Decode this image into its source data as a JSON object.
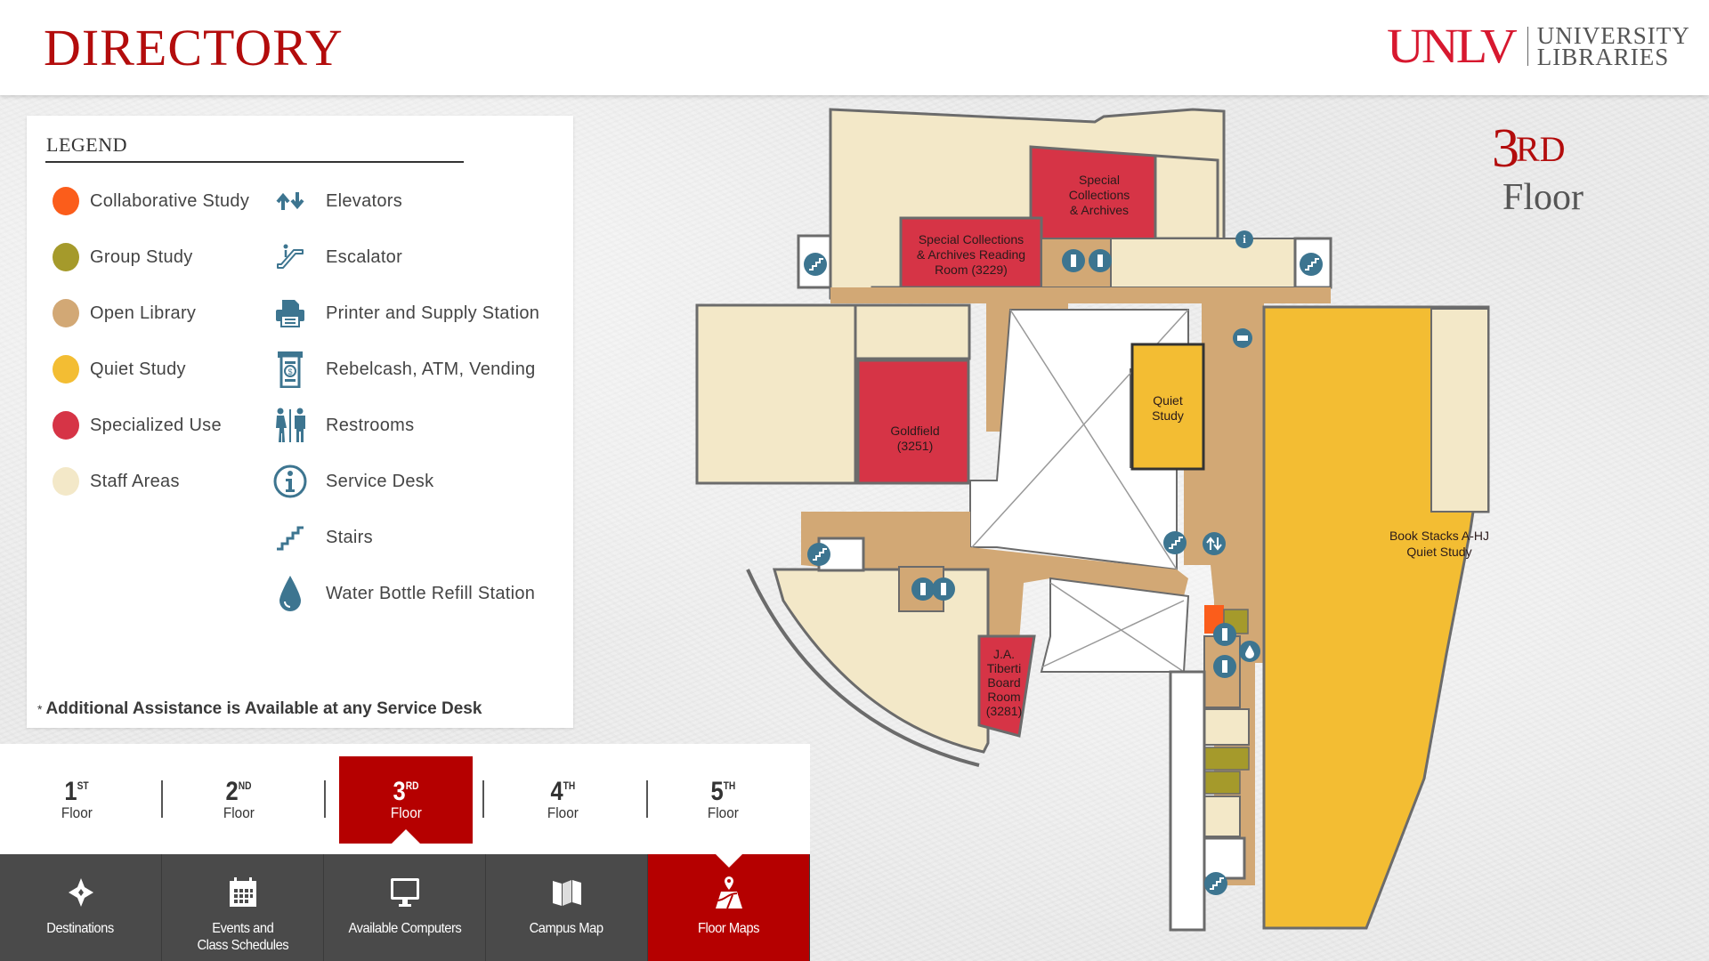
{
  "header": {
    "title": "DIRECTORY",
    "logo": {
      "primary": "UNLV",
      "line1": "UNIVERSITY",
      "line2": "LIBRARIES"
    }
  },
  "legend": {
    "title": "LEGEND",
    "area_types": [
      {
        "label": "Collaborative Study",
        "color": "#fb5d1b"
      },
      {
        "label": "Group Study",
        "color": "#a59a2b"
      },
      {
        "label": "Open Library",
        "color": "#d2a875"
      },
      {
        "label": "Quiet Study",
        "color": "#f3bd33"
      },
      {
        "label": "Specialized Use",
        "color": "#d63446"
      },
      {
        "label": "Staff Areas",
        "color": "#f3e8c8"
      }
    ],
    "amenities": [
      {
        "label": "Elevators",
        "icon": "elevator-icon"
      },
      {
        "label": "Escalator",
        "icon": "escalator-icon"
      },
      {
        "label": "Printer and Supply Station",
        "icon": "printer-icon"
      },
      {
        "label": "Rebelcash, ATM, Vending",
        "icon": "atm-icon"
      },
      {
        "label": "Restrooms",
        "icon": "restroom-icon"
      },
      {
        "label": "Service Desk",
        "icon": "info-icon"
      },
      {
        "label": "Stairs",
        "icon": "stairs-icon"
      },
      {
        "label": "Water Bottle Refill Station",
        "icon": "water-drop-icon"
      }
    ],
    "note_mark": "*",
    "note": "Additional Assistance is Available at any Service Desk",
    "icon_color": "#3d7590"
  },
  "floor_heading": {
    "number": "3",
    "suffix": "RD",
    "word": "Floor"
  },
  "floor_selector": {
    "selected": 2,
    "floors": [
      {
        "number": "1",
        "suffix": "ST",
        "label": "Floor"
      },
      {
        "number": "2",
        "suffix": "ND",
        "label": "Floor"
      },
      {
        "number": "3",
        "suffix": "RD",
        "label": "Floor"
      },
      {
        "number": "4",
        "suffix": "TH",
        "label": "Floor"
      },
      {
        "number": "5",
        "suffix": "TH",
        "label": "Floor"
      }
    ]
  },
  "nav": {
    "selected": 4,
    "items": [
      {
        "label": "Destinations",
        "icon": "compass-star-icon"
      },
      {
        "label": "Events and\nClass Schedules",
        "icon": "calendar-icon"
      },
      {
        "label": "Available Computers",
        "icon": "monitor-icon"
      },
      {
        "label": "Campus Map",
        "icon": "folded-map-icon"
      },
      {
        "label": "Floor Maps",
        "icon": "floor-map-pin-icon"
      }
    ]
  },
  "map": {
    "rooms": {
      "special_collections": [
        "Special",
        "Collections",
        "& Archives"
      ],
      "reading_room": [
        "Special Collections",
        "& Archives Reading",
        "Room (3229)"
      ],
      "goldfield": [
        "Goldfield",
        "(3251)"
      ],
      "quiet_study": [
        "Quiet",
        "Study"
      ],
      "book_stacks": [
        "Book Stacks A-HJ",
        "Quiet Study"
      ],
      "tiberti": [
        "J.A.",
        "Tiberti",
        "Board",
        "Room",
        "(3281)"
      ]
    },
    "colors": {
      "staff": "#f3e8c8",
      "open": "#d2a875",
      "quiet": "#f3bd33",
      "special": "#d63446",
      "group": "#a59a2b",
      "collab": "#fb5d1b",
      "wall": "#6b6b6b",
      "marker": "#3d7590",
      "void": "#ffffff"
    }
  },
  "theme": {
    "brand_red": "#b30c0c",
    "nav_bg": "#4a4a4a",
    "nav_active": "#b50000"
  }
}
